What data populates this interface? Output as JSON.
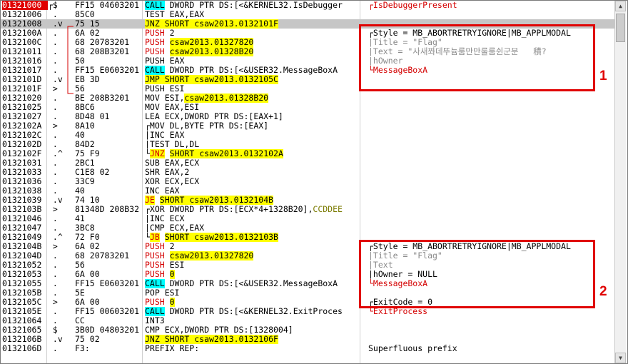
{
  "rows": [
    {
      "addr": "01321000",
      "eip": true,
      "mk": "┌$",
      "hex": "FF15 04603201",
      "pre": "",
      "kw": "CALL",
      "kwc": "ch",
      "post": " DWORD PTR DS:[<&KERNEL32.IsDebugger",
      "cmt": [
        {
          "t": "┌IsDebuggerPresent",
          "c": "rd"
        }
      ]
    },
    {
      "addr": "01321006",
      "mk": " .",
      "hex": "85C0",
      "pre": "TEST EAX,EAX"
    },
    {
      "addr": "01321008",
      "cur": true,
      "mk": " .v",
      "hex": "75 15",
      "pre": "",
      "kw": "JNZ SHORT csaw2013.0132101F",
      "kwc": "hl"
    },
    {
      "addr": "0132100A",
      "mk": " .",
      "hex": "6A 02",
      "pre": "",
      "kw": "PUSH",
      "kwc": "rd",
      "post": " 2",
      "cmt": [
        {
          "t": "┌Style = MB_ABORTRETRYIGNORE|MB_APPLMODAL"
        }
      ]
    },
    {
      "addr": "0132100C",
      "mk": " .",
      "hex": "68 20783201",
      "pre": "",
      "kw": "PUSH",
      "kwc": "rd",
      "post": " ",
      "kw2": "csaw2013.01327820",
      "kw2c": "hl",
      "cmt": [
        {
          "t": "|Title = \"Flag\"",
          "c": "gy"
        }
      ]
    },
    {
      "addr": "01321011",
      "mk": " .",
      "hex": "68 208B3201",
      "pre": "",
      "kw": "PUSH",
      "kwc": "rd",
      "post": " ",
      "kw2": "csaw2013.01328B20",
      "kw2c": "hl",
      "cmt": [
        {
          "t": "|Text = \"사새쫘데뚜늄룸만만룰룸쉰군분   積?",
          "c": "gy"
        }
      ]
    },
    {
      "addr": "01321016",
      "mk": " .",
      "hex": "50",
      "pre": "PUSH EAX",
      "cmt": [
        {
          "t": "|hOwner",
          "c": "gy"
        }
      ]
    },
    {
      "addr": "01321017",
      "mk": " .",
      "hex": "FF15 E0603201",
      "pre": "",
      "kw": "CALL",
      "kwc": "ch",
      "post": " DWORD PTR DS:[<&USER32.MessageBoxA",
      "cmt": [
        {
          "t": "└MessageBoxA",
          "c": "rd"
        }
      ]
    },
    {
      "addr": "0132101D",
      "mk": " .v",
      "hex": "EB 3D",
      "pre": "",
      "kw": "JMP SHORT csaw2013.0132105C",
      "kwc": "hl"
    },
    {
      "addr": "0132101F",
      "mk": " >",
      "hex": "56",
      "pre": "PUSH ESI"
    },
    {
      "addr": "01321020",
      "mk": " .",
      "hex": "BE 208B3201",
      "pre": "MOV ESI,",
      "kw": "csaw2013.01328B20",
      "kwc": "hl"
    },
    {
      "addr": "01321025",
      "mk": " .",
      "hex": "8BC6",
      "pre": "MOV EAX,ESI"
    },
    {
      "addr": "01321027",
      "mk": " .",
      "hex": "8D48 01",
      "pre": "LEA ECX,DWORD PTR DS:[EAX+1]"
    },
    {
      "addr": "0132102A",
      "mk": " >",
      "hex": "8A10",
      "pre": "┌MOV DL,BYTE PTR DS:[EAX]"
    },
    {
      "addr": "0132102C",
      "mk": " .",
      "hex": "40",
      "pre": "|INC EAX"
    },
    {
      "addr": "0132102D",
      "mk": " .",
      "hex": "84D2",
      "pre": "|TEST DL,DL"
    },
    {
      "addr": "0132102F",
      "mk": " .^",
      "hex": "75 F9",
      "pre": "└",
      "kw": "JNZ",
      "kwc": "rd hl",
      "post": " ",
      "kw2": "SHORT csaw2013.0132102A",
      "kw2c": "hl"
    },
    {
      "addr": "01321031",
      "mk": " .",
      "hex": "2BC1",
      "pre": "SUB EAX,ECX"
    },
    {
      "addr": "01321033",
      "mk": " .",
      "hex": "C1E8 02",
      "pre": "SHR EAX,2"
    },
    {
      "addr": "01321036",
      "mk": " .",
      "hex": "33C9",
      "pre": "XOR ECX,ECX"
    },
    {
      "addr": "01321038",
      "mk": " .",
      "hex": "40",
      "pre": "INC EAX"
    },
    {
      "addr": "01321039",
      "mk": " .v",
      "hex": "74 10",
      "pre": "",
      "kw": "JE",
      "kwc": "rd hl",
      "post": " ",
      "kw2": "SHORT csaw2013.0132104B",
      "kw2c": "hl"
    },
    {
      "addr": "0132103B",
      "mk": " >",
      "hex": "81348D 208B32",
      "pre": "┌XOR DWORD PTR DS:[ECX*4+1328B20],",
      "kw": "CCDDEE",
      "kwc": "ol"
    },
    {
      "addr": "01321046",
      "mk": " .",
      "hex": "41",
      "pre": "|INC ECX"
    },
    {
      "addr": "01321047",
      "mk": " .",
      "hex": "3BC8",
      "pre": "|CMP ECX,EAX"
    },
    {
      "addr": "01321049",
      "mk": " .^",
      "hex": "72 F0",
      "pre": "└",
      "kw": "JB",
      "kwc": "rd hl",
      "post": " ",
      "kw2": "SHORT csaw2013.0132103B",
      "kw2c": "hl"
    },
    {
      "addr": "0132104B",
      "mk": " >",
      "hex": "6A 02",
      "pre": "",
      "kw": "PUSH",
      "kwc": "rd",
      "post": " 2",
      "cmt": [
        {
          "t": "┌Style = MB_ABORTRETRYIGNORE|MB_APPLMODAL"
        }
      ]
    },
    {
      "addr": "0132104D",
      "mk": " .",
      "hex": "68 20783201",
      "pre": "",
      "kw": "PUSH",
      "kwc": "rd",
      "post": " ",
      "kw2": "csaw2013.01327820",
      "kw2c": "hl",
      "cmt": [
        {
          "t": "|Title = \"Flag\"",
          "c": "gy"
        }
      ]
    },
    {
      "addr": "01321052",
      "mk": " .",
      "hex": "56",
      "pre": "",
      "kw": "PUSH",
      "kwc": "rd",
      "post": " ESI",
      "cmt": [
        {
          "t": "|Text",
          "c": "gy"
        }
      ]
    },
    {
      "addr": "01321053",
      "mk": " .",
      "hex": "6A 00",
      "pre": "",
      "kw": "PUSH",
      "kwc": "rd",
      "post": " ",
      "kw2": "0",
      "kw2c": "hl",
      "cmt": [
        {
          "t": "|hOwner = NULL"
        }
      ]
    },
    {
      "addr": "01321055",
      "mk": " .",
      "hex": "FF15 E0603201",
      "pre": "",
      "kw": "CALL",
      "kwc": "ch",
      "post": " DWORD PTR DS:[<&USER32.MessageBoxA",
      "cmt": [
        {
          "t": "└MessageBoxA",
          "c": "rd"
        }
      ]
    },
    {
      "addr": "0132105B",
      "mk": " .",
      "hex": "5E",
      "pre": "POP ESI"
    },
    {
      "addr": "0132105C",
      "mk": " >",
      "hex": "6A 00",
      "pre": "",
      "kw": "PUSH",
      "kwc": "rd",
      "post": " ",
      "kw2": "0",
      "kw2c": "hl",
      "cmt": [
        {
          "t": "┌ExitCode = 0"
        }
      ]
    },
    {
      "addr": "0132105E",
      "mk": " .",
      "hex": "FF15 00603201",
      "pre": "",
      "kw": "CALL",
      "kwc": "ch",
      "post": " DWORD PTR DS:[<&KERNEL32.ExitProces",
      "cmt": [
        {
          "t": "└ExitProcess",
          "c": "rd"
        }
      ]
    },
    {
      "addr": "01321064",
      "mk": " .",
      "hex": "CC",
      "pre": "INT3"
    },
    {
      "addr": "01321065",
      "mk": " $",
      "hex": "3B0D 04803201",
      "pre": "CMP ECX,DWORD PTR DS:[1328004]"
    },
    {
      "addr": "0132106B",
      "mk": " .v",
      "hex": "75 02",
      "pre": "",
      "kw": "JNZ SHORT csaw2013.0132106F",
      "kwc": "hl"
    },
    {
      "addr": "0132106D",
      "mk": " .",
      "hex": "F3:",
      "pre": "PREFIX REP:",
      "cmt": [
        {
          "t": "Superfluous prefix"
        }
      ]
    }
  ],
  "callouts": [
    {
      "label": "1"
    },
    {
      "label": "2"
    }
  ]
}
